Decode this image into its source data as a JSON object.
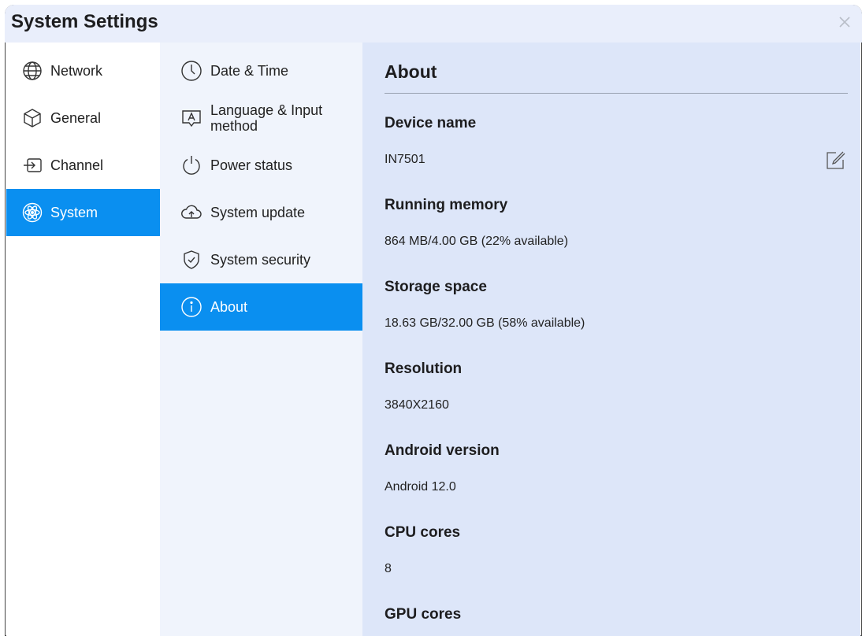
{
  "window": {
    "title": "System Settings",
    "close_icon": "close-icon"
  },
  "nav": {
    "items": [
      {
        "label": "Network",
        "icon": "globe-icon"
      },
      {
        "label": "General",
        "icon": "cube-icon"
      },
      {
        "label": "Channel",
        "icon": "input-icon"
      },
      {
        "label": "System",
        "icon": "atom-icon",
        "active": true
      }
    ]
  },
  "subnav": {
    "items": [
      {
        "label": "Date & Time",
        "icon": "clock-icon"
      },
      {
        "label_line1": "Language & Input",
        "label_line2": "method",
        "icon": "keyboard-a-icon"
      },
      {
        "label": "Power status",
        "icon": "power-icon"
      },
      {
        "label": "System update",
        "icon": "cloud-upload-icon"
      },
      {
        "label": "System security",
        "icon": "shield-check-icon"
      },
      {
        "label": "About",
        "icon": "info-icon",
        "active": true
      }
    ]
  },
  "about": {
    "title": "About",
    "device_name_label": "Device name",
    "device_name_value": "IN7501",
    "running_memory_label": "Running memory",
    "running_memory_value": "864 MB/4.00 GB (22% available)",
    "storage_label": "Storage space",
    "storage_value": "18.63 GB/32.00 GB (58% available)",
    "resolution_label": "Resolution",
    "resolution_value": "3840X2160",
    "android_label": "Android version",
    "android_value": "Android 12.0",
    "cpu_label": "CPU cores",
    "cpu_value": "8",
    "gpu_label": "GPU cores"
  },
  "colors": {
    "accent": "#0a8ff0",
    "titlebar": "#e9eefb",
    "subnav_bg": "#f0f4fc",
    "content_bg": "#dde6f9"
  }
}
